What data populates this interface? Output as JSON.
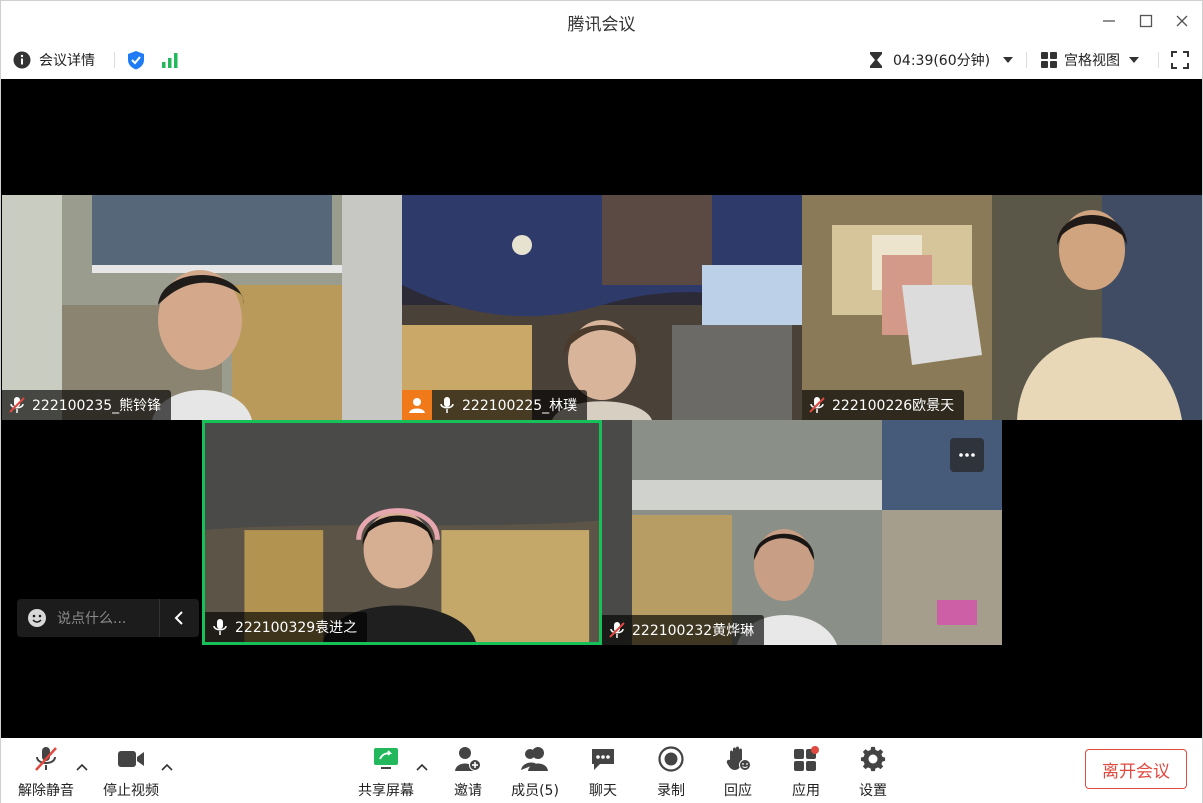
{
  "window": {
    "title": "腾讯会议"
  },
  "infobar": {
    "meeting_details": "会议详情",
    "timer": "04:39(60分钟)",
    "view_mode": "宫格视图"
  },
  "participants": [
    {
      "name": "222100235_熊铃锋",
      "muted": true
    },
    {
      "name": "222100225_林璞",
      "muted": false,
      "camera_badge": true
    },
    {
      "name": "222100226欧景天",
      "muted": true
    },
    {
      "name": "222100329袁进之",
      "muted": false,
      "active_speaker": true
    },
    {
      "name": "222100232黄烨琳",
      "muted": true
    }
  ],
  "chat": {
    "placeholder": "说点什么..."
  },
  "toolbar": {
    "unmute": "解除静音",
    "stop_video": "停止视频",
    "share_screen": "共享屏幕",
    "invite": "邀请",
    "members": "成员(5)",
    "chat": "聊天",
    "record": "录制",
    "react": "回应",
    "apps": "应用",
    "settings": "设置",
    "leave": "离开会议"
  },
  "colors": {
    "accent_blue": "#1f7cf5",
    "signal_green": "#22b85b",
    "active_border": "#16c15a",
    "leave_red": "#e0493f",
    "badge_orange": "#f07a1a"
  }
}
